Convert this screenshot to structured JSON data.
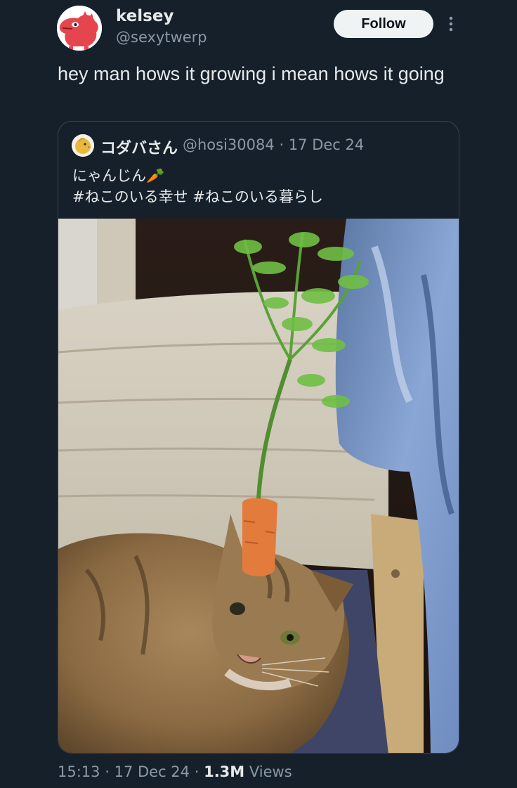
{
  "author": {
    "name": "kelsey",
    "handle": "@sexytwerp",
    "avatar_icon": "red-dinosaur-avatar"
  },
  "follow_label": "Follow",
  "tweet_text": "hey man hows it growing i mean hows it going",
  "quoted": {
    "name": "コダバさん",
    "handle": "@hosi30084",
    "separator": "·",
    "date": "17 Dec 24",
    "line1": "にゃんじん🥕",
    "line2": "#ねこのいる幸せ #ねこのいる暮らし",
    "photo_icon": "cat-with-carrot-photo"
  },
  "footer": {
    "time": "15:13",
    "date": "17 Dec 24",
    "views_count": "1.3M",
    "views_label": "Views",
    "separator": "·"
  },
  "colors": {
    "background": "#15202b",
    "text_primary": "#e7e9ea",
    "text_secondary": "#8b98a5",
    "border": "#38444d",
    "follow_bg": "#eff3f4"
  }
}
